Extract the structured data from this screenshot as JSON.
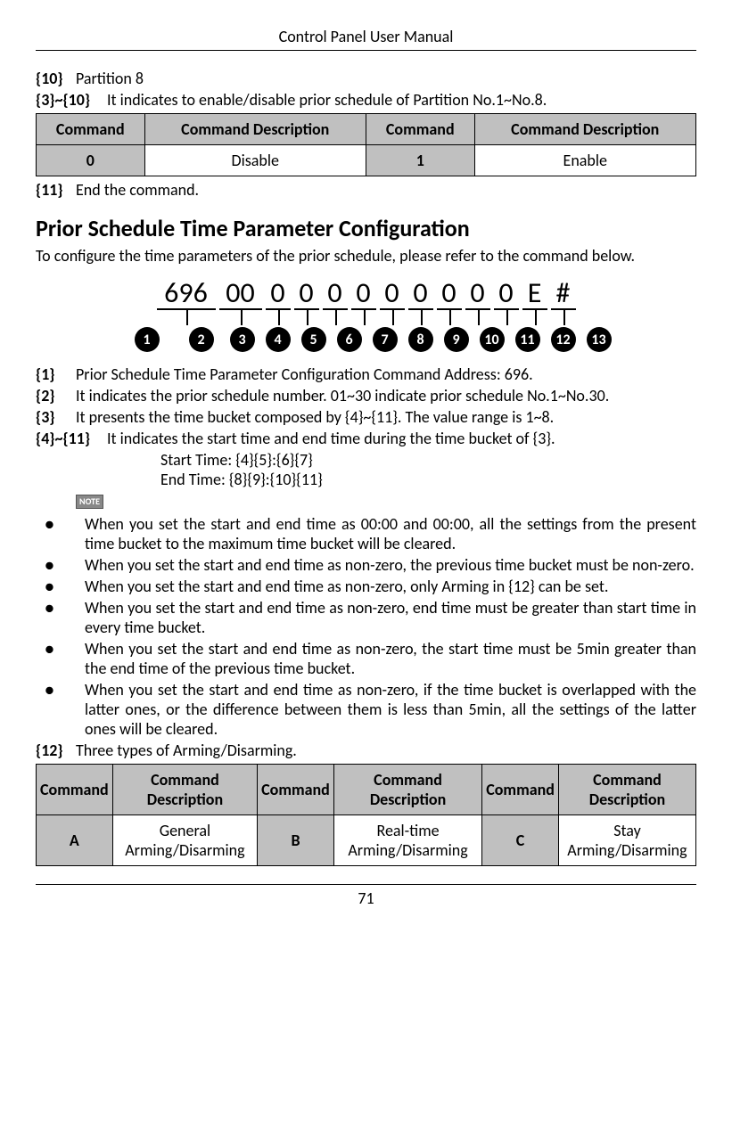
{
  "header": {
    "title": "Control Panel User Manual"
  },
  "footer": {
    "page": "71"
  },
  "top_items": [
    {
      "key": "{10}",
      "text": "Partition 8"
    },
    {
      "key": "{3}~{10}",
      "text": "It indicates to enable/disable prior schedule of Partition No.1~No.8."
    }
  ],
  "table1": {
    "headers": [
      "Command",
      "Command Description",
      "Command",
      "Command Description"
    ],
    "rows": [
      {
        "c1": "0",
        "d1": "Disable",
        "c2": "1",
        "d2": "Enable"
      }
    ]
  },
  "item11": {
    "key": "{11}",
    "text": "End the command."
  },
  "section": {
    "title": "Prior Schedule Time Parameter Configuration",
    "intro": "To configure the time parameters of the prior schedule, please refer to the command below."
  },
  "diagram": {
    "segments": [
      "696",
      "00",
      "0",
      "0",
      "0",
      "0",
      "0",
      "0",
      "0",
      "0",
      "0",
      "E",
      "#"
    ],
    "numbers": [
      "1",
      "2",
      "3",
      "4",
      "5",
      "6",
      "7",
      "8",
      "9",
      "10",
      "11",
      "12",
      "13"
    ]
  },
  "definitions": [
    {
      "key": "{1}",
      "text": "Prior Schedule Time Parameter Configuration Command Address: 696."
    },
    {
      "key": "{2}",
      "text": "It indicates the prior schedule number. 01~30 indicate prior schedule No.1~No.30."
    },
    {
      "key": "{3}",
      "text": "It presents the time bucket composed by {4}~{11}. The value range is 1~8."
    }
  ],
  "def411": {
    "key": "{4}~{11}",
    "text": "It indicates the start time and end time during the time bucket of {3}.",
    "start": "Start Time: {4}{5}:{6}{7}",
    "end": "End Time: {8}{9}:{10}{11}"
  },
  "note_label": "NOTE",
  "notes": [
    "When you set the start and end time as 00:00 and 00:00, all the settings from the present time bucket to the maximum time bucket will be cleared.",
    "When you set the start and end time as non-zero, the previous time bucket must be non-zero.",
    "When you set the start and end time as non-zero, only Arming in {12} can be set.",
    "When you set the start and end time as non-zero, end time must be greater than start time in every time bucket.",
    "When you set the start and end time as non-zero, the start time must be 5min greater than the end time of the previous time bucket.",
    "When you set the start and end time as non-zero, if the time bucket is overlapped with the latter ones, or the difference between them is less than 5min, all the settings of the latter ones will be cleared."
  ],
  "item12": {
    "key": "{12}",
    "text": "Three types of Arming/Disarming."
  },
  "table2": {
    "headers": [
      "Command",
      "Command Description",
      "Command",
      "Command Description",
      "Command",
      "Command Description"
    ],
    "rows": [
      {
        "c1": "A",
        "d1": "General Arming/Disarming",
        "c2": "B",
        "d2": "Real-time Arming/Disarming",
        "c3": "C",
        "d3": "Stay Arming/Disarming"
      }
    ]
  }
}
